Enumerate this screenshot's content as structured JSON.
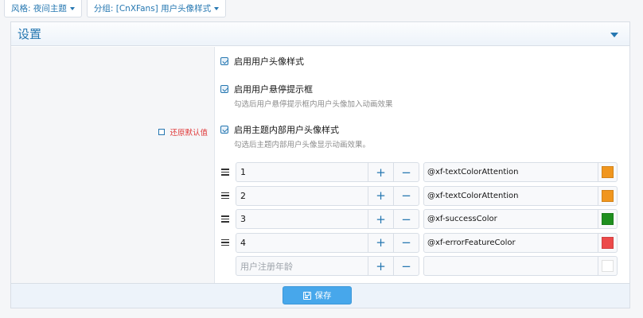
{
  "topbar": {
    "style_label": "风格: 夜间主题",
    "group_label": "分组: [CnXFans] 用户头像样式"
  },
  "block": {
    "title": "设置"
  },
  "reset": {
    "label": "还原默认值"
  },
  "options": [
    {
      "label": "启用用户头像样式",
      "hint": "",
      "checked": true
    },
    {
      "label": "启用用户悬停提示框",
      "hint": "勾选后用户悬停提示框内用户头像加入动画效果",
      "checked": true
    },
    {
      "label": "启用主题内部用户头像样式",
      "hint": "勾选后主题内部用户头像显示动画效果。",
      "checked": true
    }
  ],
  "rows": [
    {
      "value": "1",
      "placeholder": "",
      "color_var": "@xf-textColorAttention",
      "swatch": "#f0961e"
    },
    {
      "value": "2",
      "placeholder": "",
      "color_var": "@xf-textColorAttention",
      "swatch": "#f0961e"
    },
    {
      "value": "3",
      "placeholder": "",
      "color_var": "@xf-successColor",
      "swatch": "#1f8f1f"
    },
    {
      "value": "4",
      "placeholder": "",
      "color_var": "@xf-errorFeatureColor",
      "swatch": "#ec4a4a"
    },
    {
      "value": "",
      "placeholder": "用户注册年龄",
      "color_var": "",
      "swatch": "#ffffff"
    }
  ],
  "stepper": {
    "plus": "+",
    "minus": "−"
  },
  "footer": {
    "save_label": "保存"
  },
  "colors": {
    "accent": "#2577b1",
    "button": "#47a7eb",
    "danger": "#e03a3a"
  },
  "icons": {
    "caret": "chevron-down-icon",
    "drag": "drag-handle-icon",
    "save": "save-icon"
  }
}
